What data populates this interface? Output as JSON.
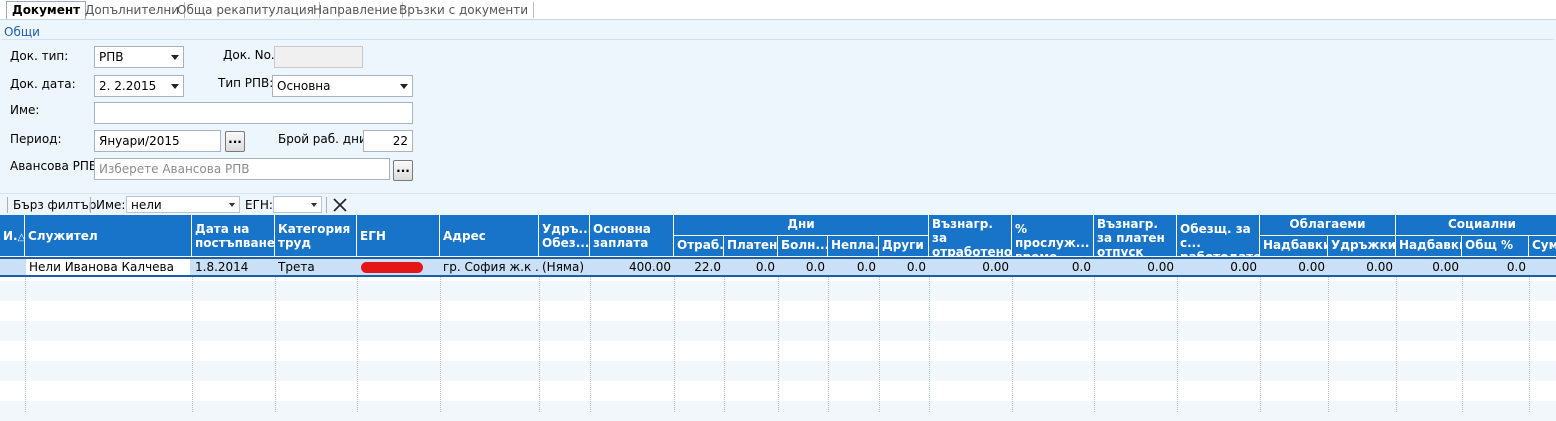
{
  "tabs": [
    "Документ",
    "Допълнителни",
    "Обща рекапитулация",
    "Направление",
    "Връзки с документи"
  ],
  "group_title": "Общи",
  "form": {
    "doc_type_label": "Док. тип:",
    "doc_type_value": "РПВ",
    "doc_no_label": "Док. No.",
    "doc_no_value": "",
    "doc_date_label": "Док. дата:",
    "doc_date_value": "2.  2.2015",
    "rpv_type_label": "Тип РПВ:",
    "rpv_type_value": "Основна",
    "name_label": "Име:",
    "name_value": "",
    "period_label": "Период:",
    "period_value": "Януари/2015",
    "work_days_label": "Брой раб. дни:",
    "work_days_value": "22",
    "advance_label": "Авансова РПВ:",
    "advance_placeholder": "Изберете Авансова РПВ",
    "browse_label": "..."
  },
  "filter": {
    "quick_label": "Бърз филтър",
    "name_label": "Име:",
    "name_value": "нели",
    "egn_label": "ЕГН:",
    "egn_value": ""
  },
  "grid": {
    "headers": {
      "id": "И.",
      "sort_icon": "△",
      "employee": "Служител",
      "start_date": "Дата на постъпване",
      "work_category": "Категория труд",
      "egn": "ЕГН",
      "address": "Адрес",
      "deductions": "Удръ... Обез...",
      "base_salary": "Основна заплата",
      "days_group": "Дни",
      "days_worked": "Отраб...",
      "days_paid": "Платен...",
      "days_sick": "Болн...",
      "days_unpaid": "Непла...",
      "days_other": "Други",
      "pay_worked": "Възнагр. за отработено време",
      "service_pct": "% прослуж... време",
      "pay_paid_leave": "Възнагр. за платен отпуск",
      "employer_insurance": "Обезщ. за с... работодателя",
      "taxable_group": "Облагаеми",
      "taxable_bonus": "Надбавки",
      "taxable_deductions": "Удръжки",
      "social_group": "Социални разходи",
      "social_bonus": "Надбавки",
      "social_total_pct": "Общ %",
      "social_sum": "Сума"
    },
    "rows": [
      {
        "employee": "Нели Иванова Калчева",
        "start_date": "1.8.2014",
        "work_category": "Трета",
        "egn": "",
        "address": "гр. София ж.к ...",
        "deductions": "(Няма)",
        "base_salary": "400.00",
        "days_worked": "22.0",
        "days_paid": "0.0",
        "days_sick": "0.0",
        "days_unpaid": "0.0",
        "days_other": "0.0",
        "pay_worked": "0.00",
        "service_pct": "0.0",
        "pay_paid_leave": "0.00",
        "employer_insurance": "0.00",
        "taxable_bonus": "0.00",
        "taxable_deductions": "0.00",
        "social_bonus": "0.00",
        "social_total_pct": "0.0"
      }
    ]
  },
  "colors": {
    "header_bg": "#1874c8",
    "panel_bg": "#eef6fd",
    "selected_row": "#c9e0f6",
    "group_title": "#1d5eaa",
    "redaction": "#e41616"
  }
}
